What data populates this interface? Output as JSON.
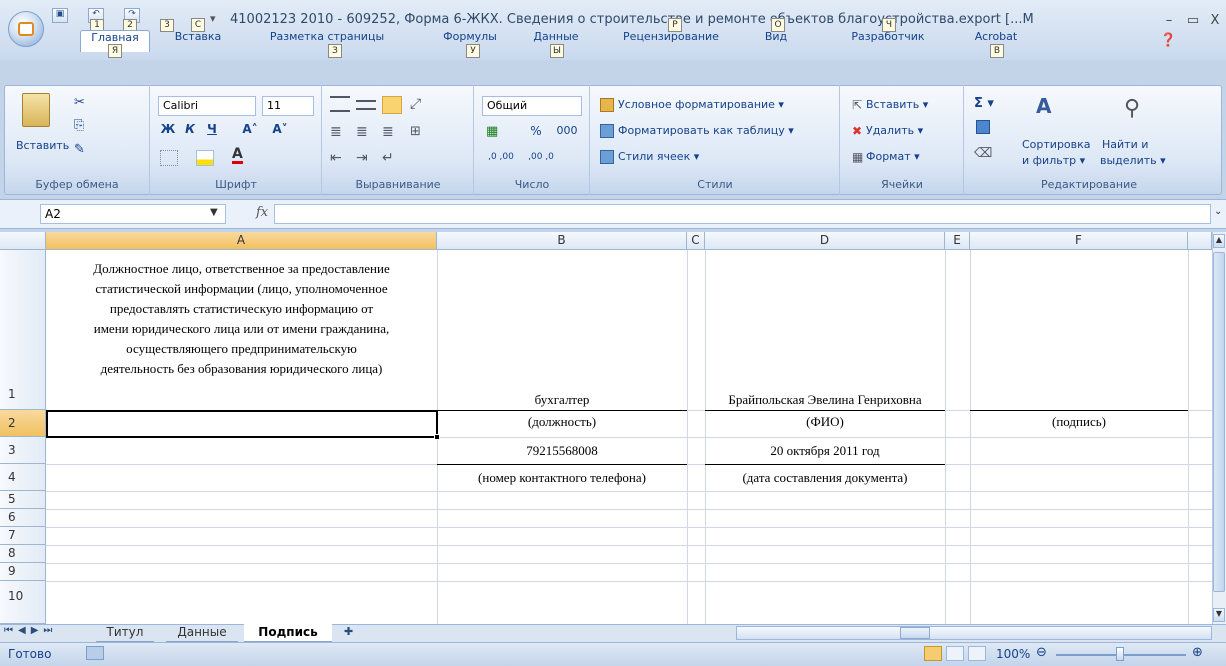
{
  "window": {
    "title": "41002123 2010 - 609252, Форма 6-ЖКХ. Сведения о строительстве и ремонте объектов благоустройства.export  [...M",
    "controls": [
      "–",
      "▭",
      "X"
    ],
    "qat_keytips": [
      "1",
      "2",
      "3"
    ]
  },
  "ribbon": {
    "tabs": [
      {
        "label": "Главная",
        "key": "Я"
      },
      {
        "label": "Вставка",
        "key": "С"
      },
      {
        "label": "Разметка страницы",
        "key": "З"
      },
      {
        "label": "Формулы",
        "key": "У"
      },
      {
        "label": "Данные",
        "key": "Ы"
      },
      {
        "label": "Рецензирование",
        "key": "Р"
      },
      {
        "label": "Вид",
        "key": "О"
      },
      {
        "label": "Разработчик",
        "key": "Ч"
      },
      {
        "label": "Acrobat",
        "key": "В"
      }
    ],
    "clipboard": {
      "paste": "Вставить",
      "group": "Буфер обмена"
    },
    "font": {
      "name": "Calibri",
      "size": "11",
      "bold": "Ж",
      "italic": "К",
      "underline": "Ч",
      "grow": "A˄",
      "shrink": "A˅",
      "group": "Шрифт"
    },
    "alignment": {
      "group": "Выравнивание"
    },
    "number": {
      "format": "Общий",
      "percent": "%",
      "thousands": "000",
      "inc": ",0 ,00",
      "dec": ",00 ,0",
      "group": "Число"
    },
    "styles": {
      "conditional": "Условное форматирование ▾",
      "as_table": "Форматировать как таблицу ▾",
      "cell_styles": "Стили ячеек ▾",
      "group": "Стили"
    },
    "cells": {
      "insert": "Вставить ▾",
      "delete": "Удалить ▾",
      "format": "Формат ▾",
      "group": "Ячейки"
    },
    "editing": {
      "sum": "Σ ▾",
      "sort_line1": "Сортировка",
      "sort_line2": "и фильтр ▾",
      "find_line1": "Найти и",
      "find_line2": "выделить ▾",
      "group": "Редактирование"
    }
  },
  "formula_bar": {
    "name_box": "A2",
    "fx": "fx",
    "value": ""
  },
  "columns": [
    "A",
    "B",
    "C",
    "D",
    "E",
    "F"
  ],
  "rows": [
    "1",
    "2",
    "3",
    "4",
    "5",
    "6",
    "7",
    "8",
    "9",
    "10"
  ],
  "cells": {
    "a1_lines": [
      "Должностное лицо, ответственное за предоставление",
      "статистической информации (лицо, уполномоченное",
      "предоставлять статистическую информацию от",
      "имени юридического лица или от имени гражданина,",
      "осуществляющего предпринимательскую",
      "деятельность без образования юридического лица)"
    ],
    "b1": "бухгалтер",
    "d1": "Брайпольская Эвелина Генриховна",
    "b2": "(должность)",
    "d2": "(ФИО)",
    "f2": "(подпись)",
    "b3": "79215568008",
    "d3": "20 октября 2011 год",
    "b4": "(номер контактного телефона)",
    "d4": "(дата составления документа)"
  },
  "sheets": [
    {
      "label": "Титул",
      "active": false
    },
    {
      "label": "Данные",
      "active": false
    },
    {
      "label": "Подпись",
      "active": true
    }
  ],
  "status": {
    "ready": "Готово",
    "zoom": "100%"
  }
}
